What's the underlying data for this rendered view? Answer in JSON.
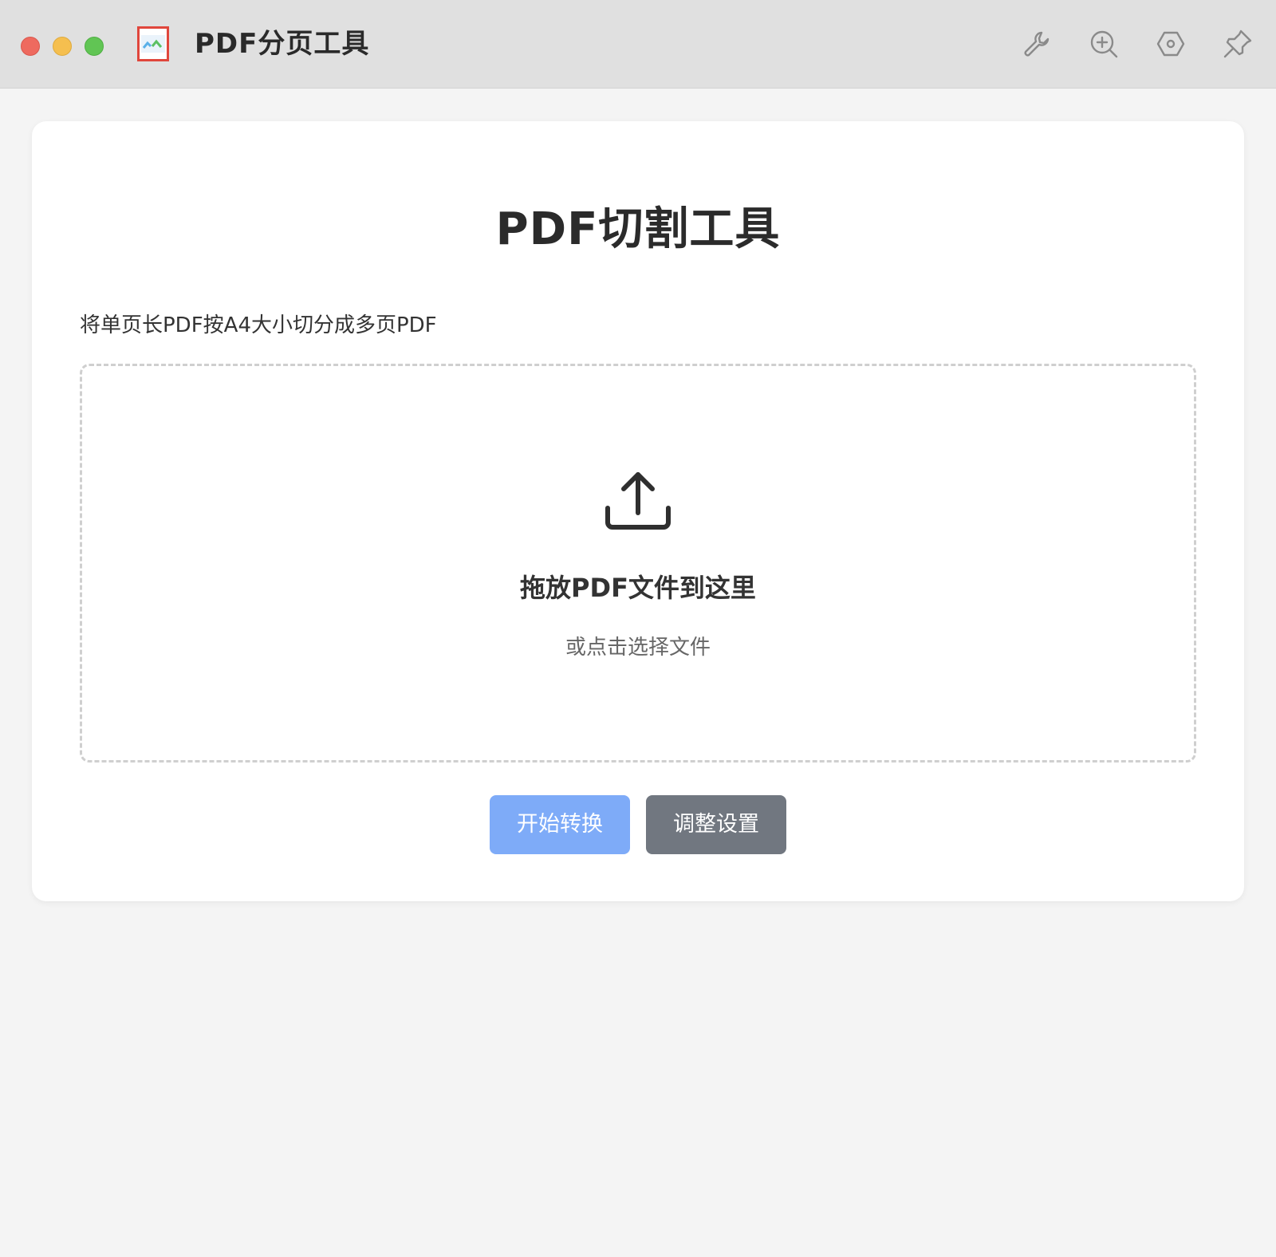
{
  "window": {
    "title": "PDF分页工具",
    "controls": [
      "close",
      "minimize",
      "maximize"
    ]
  },
  "toolbar": {
    "icons": [
      "wrench-icon",
      "zoom-in-icon",
      "settings-hexagon-icon",
      "pin-icon"
    ]
  },
  "main": {
    "title": "PDF切割工具",
    "description": "将单页长PDF按A4大小切分成多页PDF",
    "dropzone": {
      "icon": "upload-icon",
      "title": "拖放PDF文件到这里",
      "subtitle": "或点击选择文件"
    },
    "buttons": {
      "convert": "开始转换",
      "settings": "调整设置"
    }
  },
  "colors": {
    "titlebar_bg": "#e0e0e0",
    "page_bg": "#f4f4f4",
    "card_bg": "#ffffff",
    "primary_button": "#7eabf8",
    "secondary_button": "#717780",
    "dropzone_border": "#cfcfcf",
    "close": "#ee6a5f",
    "minimize": "#f5bf4f",
    "maximize": "#61c554"
  }
}
